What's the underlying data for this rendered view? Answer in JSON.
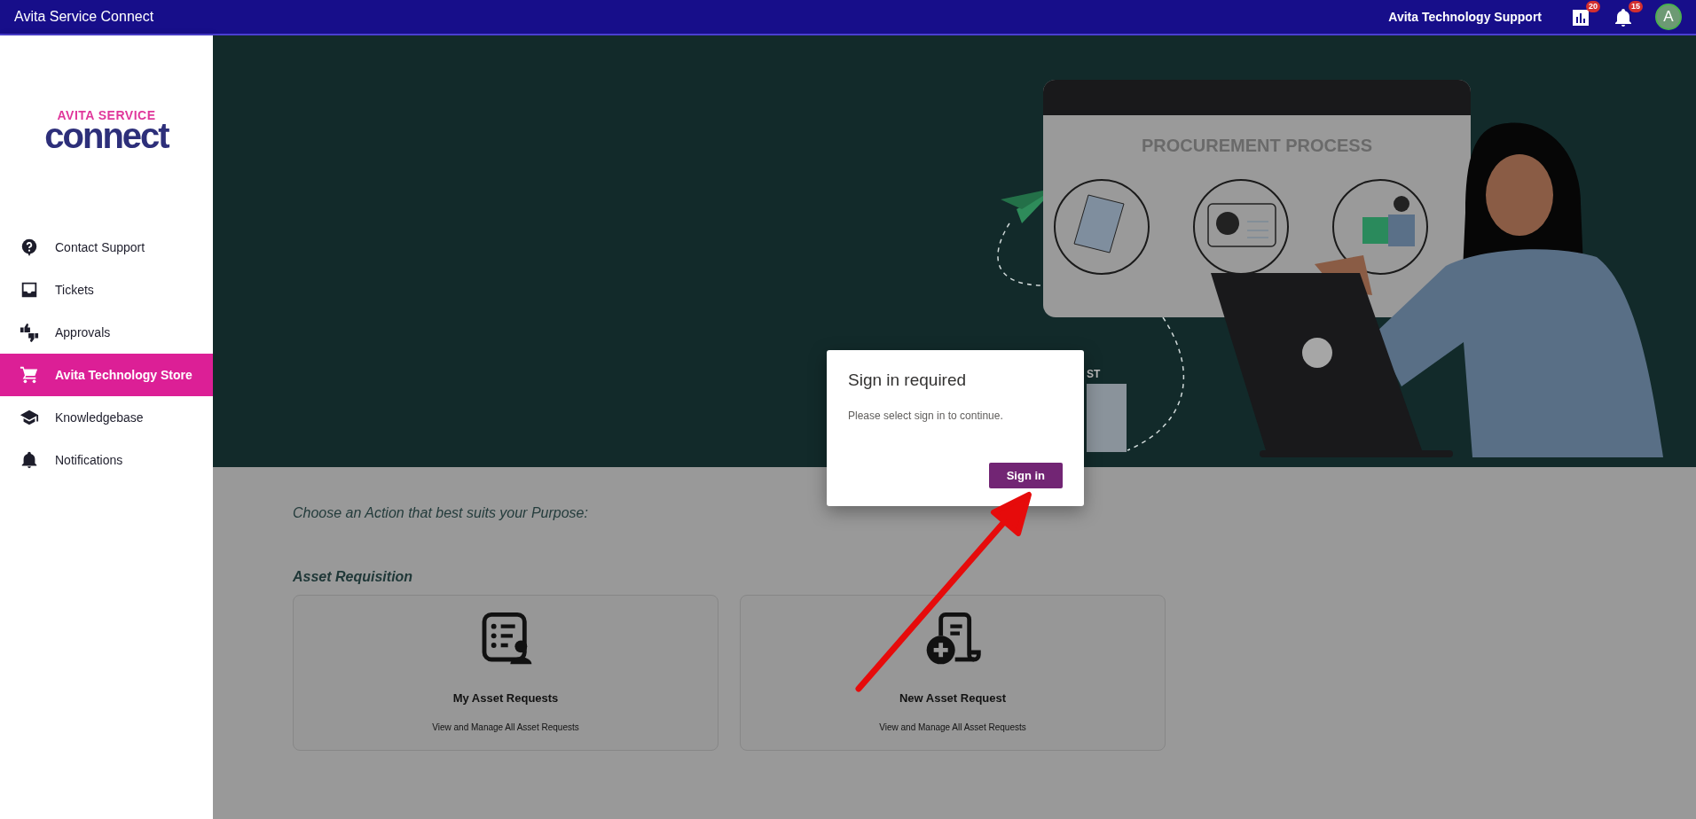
{
  "app_bar": {
    "title": "Avita Service Connect",
    "user_label": "Avita Technology Support",
    "report_badge": "20",
    "notification_badge": "15",
    "avatar_letter": "A"
  },
  "logo": {
    "top": "AVITA SERVICE",
    "bottom": "connect"
  },
  "sidebar": {
    "items": [
      {
        "kind": "help",
        "label": "Contact Support",
        "selected": false
      },
      {
        "kind": "inbox",
        "label": "Tickets",
        "selected": false
      },
      {
        "kind": "thumbs",
        "label": "Approvals",
        "selected": false
      },
      {
        "kind": "cart",
        "label": "Avita Technology Store",
        "selected": true
      },
      {
        "kind": "school",
        "label": "Knowledgebase",
        "selected": false
      },
      {
        "kind": "bell",
        "label": "Notifications",
        "selected": false
      }
    ]
  },
  "hero": {
    "board_title": "PROCUREMENT PROCESS",
    "card_fragment": "ST"
  },
  "content": {
    "prompt": "Choose an Action that best suits your Purpose:",
    "section_title": "Asset Requisition",
    "cards": [
      {
        "kind": "list-person",
        "title": "My Asset Requests",
        "description": "View and Manage All Asset Requests"
      },
      {
        "kind": "doc-plus",
        "title": "New Asset Request",
        "description": "View and Manage All Asset Requests"
      }
    ]
  },
  "dialog": {
    "title": "Sign in required",
    "message": "Please select sign in to continue.",
    "button": "Sign in"
  }
}
